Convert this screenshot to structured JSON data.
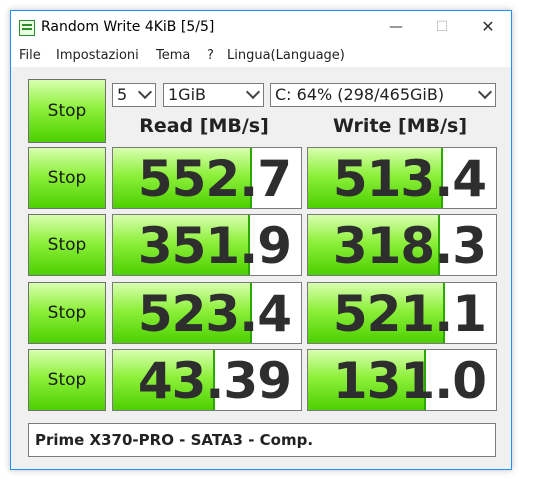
{
  "window": {
    "title": "Random Write 4KiB [5/5]"
  },
  "titlebar": {
    "minimize": "—",
    "maximize": "☐",
    "close": "✕"
  },
  "menu": [
    "File",
    "Impostazioni",
    "Tema",
    "?",
    "Lingua(Language)"
  ],
  "controls": {
    "count": "5",
    "size": "1GiB",
    "drive": "C: 64% (298/465GiB)"
  },
  "stop_label": "Stop",
  "headers": {
    "read": "Read [MB/s]",
    "write": "Write [MB/s]"
  },
  "results": [
    {
      "read": "552.7",
      "read_fill": 0.74,
      "write": "513.4",
      "write_fill": 0.72
    },
    {
      "read": "351.9",
      "read_fill": 0.73,
      "write": "318.3",
      "write_fill": 0.7
    },
    {
      "read": "523.4",
      "read_fill": 0.74,
      "write": "521.1",
      "write_fill": 0.73
    },
    {
      "read": "43.39",
      "read_fill": 0.54,
      "write": "131.0",
      "write_fill": 0.63
    }
  ],
  "comment": "Prime X370-PRO - SATA3 - Comp.",
  "colors": {
    "green_light": "#d8ffb0",
    "green": "#4cd000",
    "accent_border": "#1e90ff"
  }
}
